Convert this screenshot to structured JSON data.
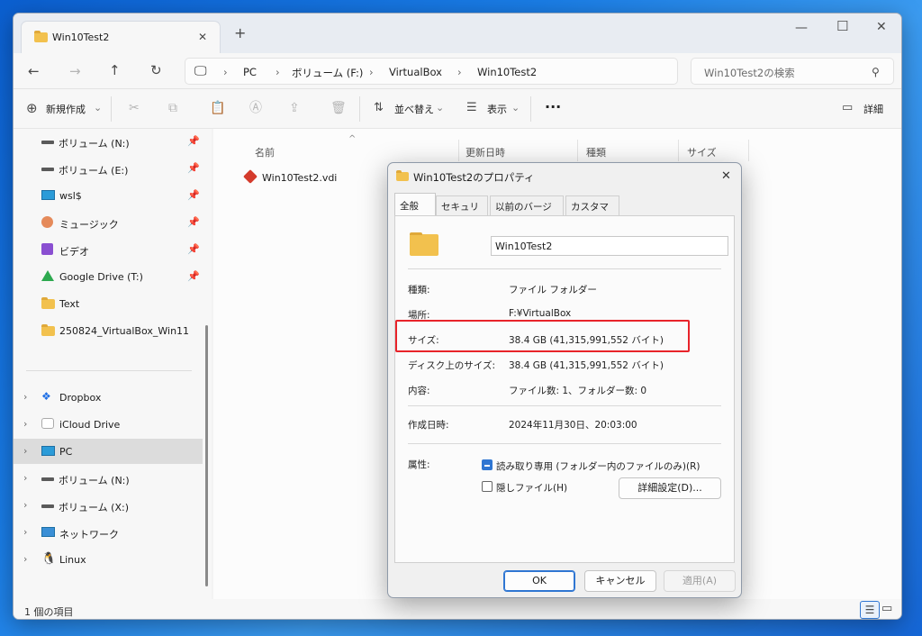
{
  "explorer": {
    "tab_title": "Win10Test2",
    "add_tab": "+",
    "breadcrumb": [
      "PC",
      "ボリューム (F:)",
      "VirtualBox",
      "Win10Test2"
    ],
    "search_placeholder": "Win10Test2の検索",
    "commands": {
      "new": "新規作成",
      "sort": "並べ替え",
      "view": "表示",
      "more": "···",
      "details": "詳細"
    },
    "sidebar": [
      {
        "label": "ボリューム (N:)",
        "icon": "drive-icon",
        "pinned": true
      },
      {
        "label": "ボリューム (E:)",
        "icon": "drive-icon",
        "pinned": true
      },
      {
        "label": "wsl$",
        "icon": "monitor-icon",
        "pinned": true
      },
      {
        "label": "ミュージック",
        "icon": "music-icon",
        "pinned": true
      },
      {
        "label": "ビデオ",
        "icon": "video-icon",
        "pinned": true
      },
      {
        "label": "Google Drive (T:)",
        "icon": "google-drive-icon",
        "pinned": true
      },
      {
        "label": "Text",
        "icon": "folder-icon",
        "pinned": false
      },
      {
        "label": "250824_VirtualBox_Win11",
        "icon": "folder-icon",
        "pinned": false
      }
    ],
    "sidebar2": [
      {
        "label": "Dropbox",
        "icon": "dropbox-icon"
      },
      {
        "label": "iCloud Drive",
        "icon": "icloud-icon"
      },
      {
        "label": "PC",
        "icon": "pc-icon",
        "selected": true
      },
      {
        "label": "ボリューム (N:)",
        "icon": "drive-icon"
      },
      {
        "label": "ボリューム (X:)",
        "icon": "drive-icon"
      },
      {
        "label": "ネットワーク",
        "icon": "network-icon"
      },
      {
        "label": "Linux",
        "icon": "linux-icon"
      }
    ],
    "columns": [
      "名前",
      "更新日時",
      "種類",
      "サイズ"
    ],
    "files": [
      {
        "name": "Win10Test2.vdi"
      }
    ],
    "status": "1 個の項目"
  },
  "dialog": {
    "title": "Win10Test2のプロパティ",
    "tabs": [
      "全般",
      "セキュリティ",
      "以前のバージョン",
      "カスタマイズ"
    ],
    "name_value": "Win10Test2",
    "rows": {
      "type_label": "種類:",
      "type_value": "ファイル フォルダー",
      "location_label": "場所:",
      "location_value": "F:¥VirtualBox",
      "size_label": "サイズ:",
      "size_value": "38.4 GB (41,315,991,552 バイト)",
      "disk_label": "ディスク上のサイズ:",
      "disk_value": "38.4 GB (41,315,991,552 バイト)",
      "contents_label": "内容:",
      "contents_value": "ファイル数: 1、フォルダー数: 0",
      "created_label": "作成日時:",
      "created_value": "2024年11月30日、20:03:00",
      "attr_label": "属性:",
      "readonly_label": "読み取り専用 (フォルダー内のファイルのみ)(R)",
      "hidden_label": "隠しファイル(H)",
      "advanced_button": "詳細設定(D)..."
    },
    "buttons": {
      "ok": "OK",
      "cancel": "キャンセル",
      "apply": "適用(A)"
    }
  },
  "colors": {
    "highlight": "#e8232a",
    "accent": "#2f76d2",
    "folder": "#f2c14e"
  }
}
